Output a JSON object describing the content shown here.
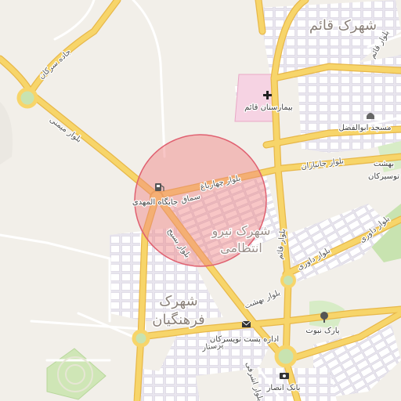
{
  "map": {
    "colors": {
      "background": "#f2efe9",
      "block": "#e3e0e8",
      "block_fill": "#ffffff",
      "road_major": "#f7d56a",
      "road_major_casing": "#e8b84a",
      "road_minor": "#ffffff",
      "green": "#c8e3b0",
      "hospital": "#f6d3e3",
      "circle_fill": "#f08080",
      "circle_stroke": "#e06070"
    },
    "highlight_circle": {
      "shape": "circle",
      "meaning": "search-radius"
    },
    "districts": [
      {
        "id": "ghaem",
        "label": "شهرک قائم"
      },
      {
        "id": "niroo",
        "label_line1": "شهرک نیرو",
        "label_line2": "انتظامی"
      },
      {
        "id": "farhangian",
        "label_line1": "شهرک",
        "label_line2": "فرهنگیان"
      }
    ],
    "roads": {
      "sarkan": "جاده سرکان",
      "meymani": "بلوار میمنی",
      "charbagh": "بلوار چهارباغ",
      "janbazan": "بلوار جانبازان",
      "ghaem_vertical": "بلوار قائم",
      "basij": "بلوار بسیج",
      "davari": "بلوار داوری",
      "behesht": "بلوار بهشت",
      "parastar": "پرستار",
      "ashrafi": "بلوار اشرفی"
    },
    "pois": {
      "gas_station": {
        "label": "جایگاه المهدی",
        "icon": "fuel-pump-icon"
      },
      "hospital": {
        "label": "بیمارستان قائم",
        "icon": "hospital-cross-icon"
      },
      "mosque": {
        "label": "مسجد ابوالفضل",
        "icon": "mosque-icon"
      },
      "cemetery": {
        "label_line1": "بهشت",
        "label_line2": "توسیرکان"
      },
      "post_office": {
        "label": "اداره پست تویسرکان",
        "icon": "mail-icon"
      },
      "park": {
        "label": "پارک نبوت",
        "icon": "tree-icon"
      },
      "bank": {
        "label": "بانک انصار",
        "icon": "bank-icon"
      },
      "samagh": {
        "label": "سماق"
      }
    }
  }
}
